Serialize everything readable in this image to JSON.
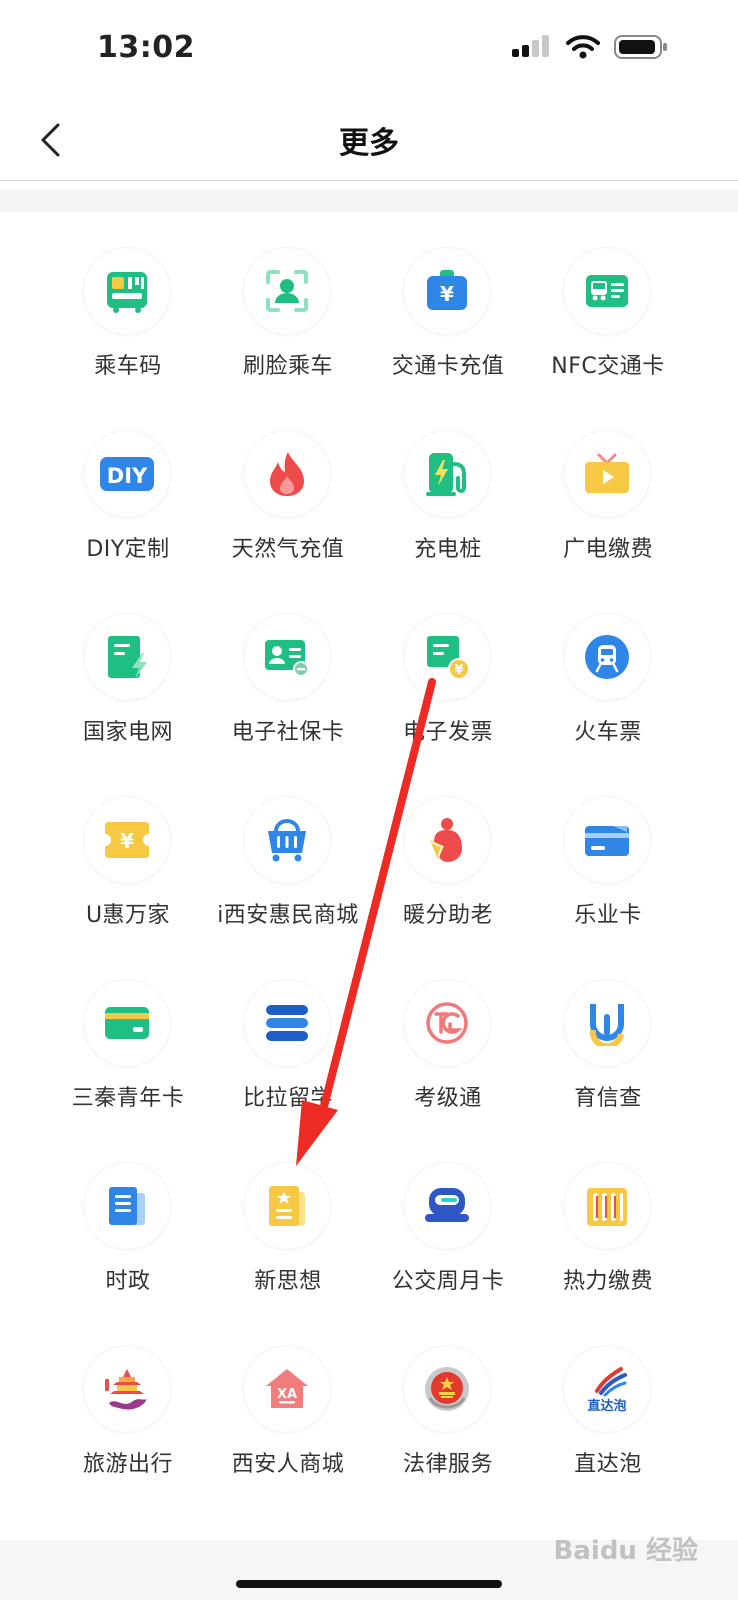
{
  "status_bar": {
    "time": "13:02"
  },
  "header": {
    "title": "更多"
  },
  "grid": [
    {
      "label": "乘车码",
      "icon": "bus-qr-icon"
    },
    {
      "label": "刷脸乘车",
      "icon": "face-scan-icon"
    },
    {
      "label": "交通卡充值",
      "icon": "yuan-card-icon"
    },
    {
      "label": "NFC交通卡",
      "icon": "nfc-bus-card-icon"
    },
    {
      "label": "DIY定制",
      "icon": "diy-icon"
    },
    {
      "label": "天然气充值",
      "icon": "flame-icon"
    },
    {
      "label": "充电桩",
      "icon": "charging-pile-icon"
    },
    {
      "label": "广电缴费",
      "icon": "tv-icon"
    },
    {
      "label": "国家电网",
      "icon": "power-grid-icon"
    },
    {
      "label": "电子社保卡",
      "icon": "social-security-card-icon"
    },
    {
      "label": "电子发票",
      "icon": "invoice-icon"
    },
    {
      "label": "火车票",
      "icon": "train-icon"
    },
    {
      "label": "U惠万家",
      "icon": "coupon-icon"
    },
    {
      "label": "i西安惠民商城",
      "icon": "shopping-basket-icon"
    },
    {
      "label": "暖分助老",
      "icon": "elder-care-icon"
    },
    {
      "label": "乐业卡",
      "icon": "bank-card-icon"
    },
    {
      "label": "三秦青年卡",
      "icon": "green-card-icon"
    },
    {
      "label": "比拉留学",
      "icon": "stack-icon"
    },
    {
      "label": "考级通",
      "icon": "exam-logo-icon"
    },
    {
      "label": "育信查",
      "icon": "education-check-icon"
    },
    {
      "label": "时政",
      "icon": "news-icon"
    },
    {
      "label": "新思想",
      "icon": "star-document-icon"
    },
    {
      "label": "公交周月卡",
      "icon": "bus-seat-icon"
    },
    {
      "label": "热力缴费",
      "icon": "radiator-icon"
    },
    {
      "label": "旅游出行",
      "icon": "pagoda-icon"
    },
    {
      "label": "西安人商城",
      "icon": "xa-house-icon"
    },
    {
      "label": "法律服务",
      "icon": "court-emblem-icon"
    },
    {
      "label": "直达泡",
      "icon": "zhidapao-logo-icon",
      "logo_text": "直达泡"
    }
  ],
  "colors": {
    "green": "#1fbf83",
    "blue": "#2f86e6",
    "yellow": "#f7c843",
    "red": "#ee4b4b",
    "arrow": "#ee2a24"
  },
  "watermark": "Baidu 经验"
}
